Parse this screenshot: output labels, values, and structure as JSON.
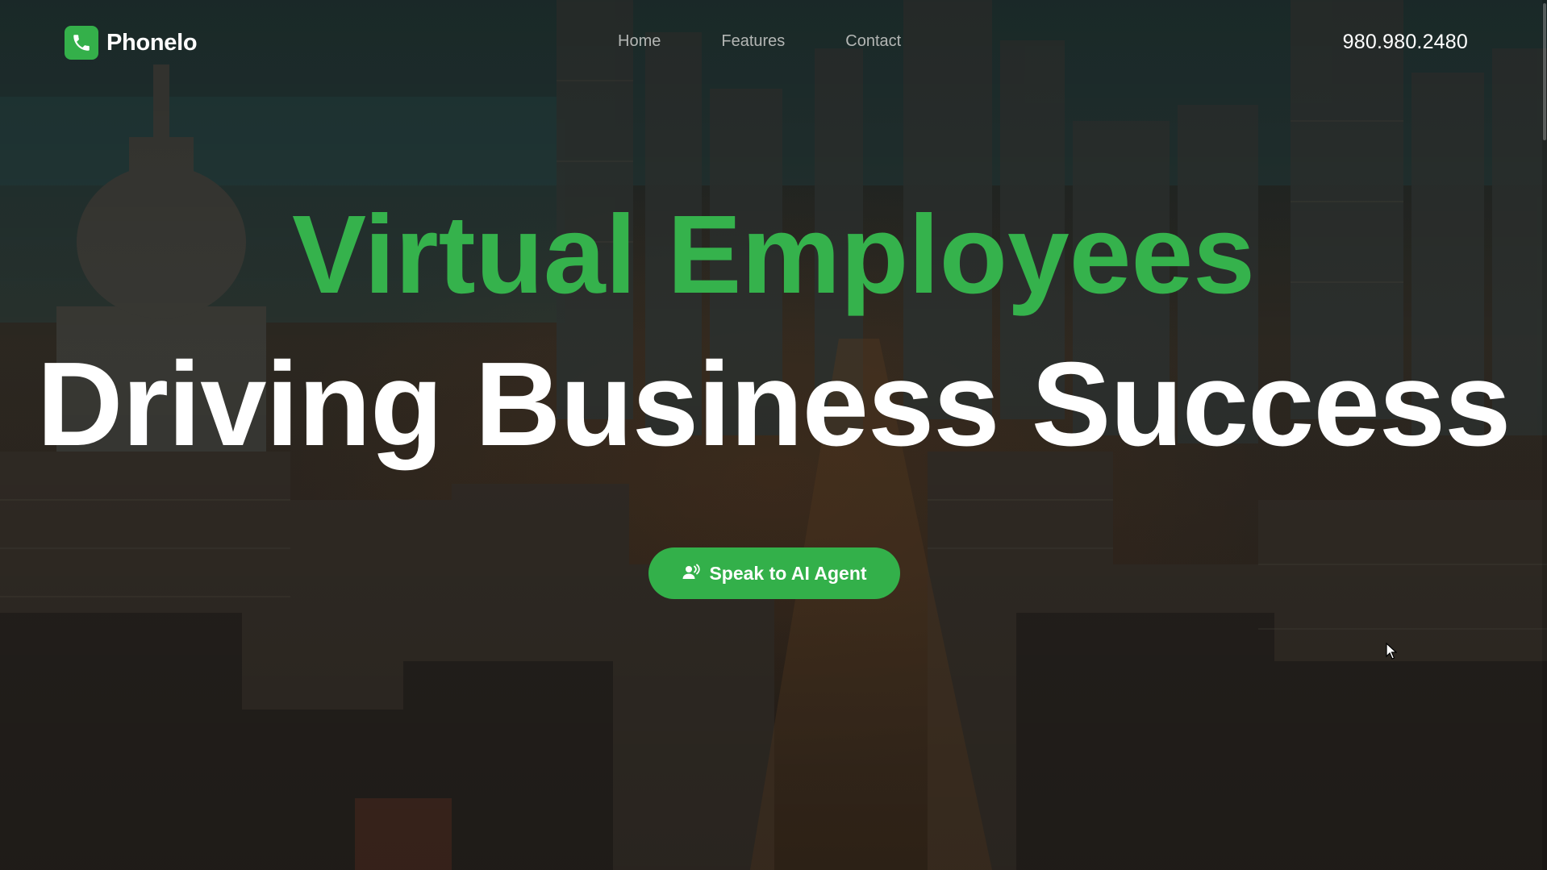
{
  "brand": {
    "name": "Phonelo",
    "logo_icon": "phone-icon",
    "accent": "#34b04a"
  },
  "nav": {
    "items": [
      {
        "label": "Home"
      },
      {
        "label": "Features"
      },
      {
        "label": "Contact"
      }
    ]
  },
  "header": {
    "phone": "980.980.2480"
  },
  "hero": {
    "headline_line1": "Virtual Employees",
    "headline_line2": "Driving Business Success",
    "cta_label": "Speak to AI Agent",
    "cta_icon": "speaking-person-icon",
    "background": "city skyline"
  }
}
